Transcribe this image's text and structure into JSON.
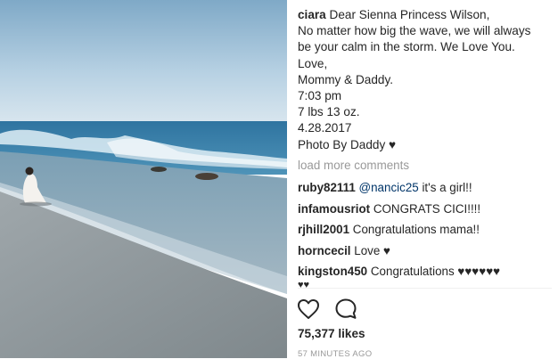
{
  "post": {
    "username": "ciara",
    "caption_lines": [
      "Dear Sienna Princess Wilson,",
      "No matter how big the wave, we will always",
      "be your calm in the storm. We Love You.",
      "Love,",
      "Mommy & Daddy.",
      "7:03 pm",
      "7 lbs 13 oz.",
      "4.28.2017",
      "Photo By Daddy ♥"
    ],
    "load_more": "load more comments",
    "comments": [
      {
        "username": "ruby82111",
        "mention": "@nancic25",
        "text": " it's a girl!!"
      },
      {
        "username": "infamousriot",
        "mention": "",
        "text": "CONGRATS CICI!!!!"
      },
      {
        "username": "rjhill2001",
        "mention": "",
        "text": "Congratulations mama!!"
      },
      {
        "username": "horncecil",
        "mention": "",
        "text": "Love ♥"
      },
      {
        "username": "kingston450",
        "mention": "",
        "text": "Congratulations ♥♥♥♥♥♥"
      }
    ],
    "overflow_hearts": "♥♥",
    "likes": "75,377 likes",
    "timestamp": "57 MINUTES AGO"
  },
  "icons": {
    "like": "heart-outline-icon",
    "comment": "speech-bubble-icon"
  },
  "colors": {
    "text": "#262626",
    "muted": "#999999",
    "mention": "#003569",
    "sky": "#9ec1d9",
    "sea": "#3f86ac",
    "sand": "#8f9aa0"
  }
}
